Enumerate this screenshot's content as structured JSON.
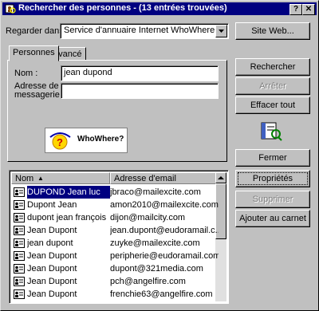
{
  "window": {
    "title": "Rechercher des personnes - (13 entrées trouvées)",
    "help_glyph": "?",
    "close_glyph": "✕"
  },
  "search": {
    "look_in_label": "Regarder dans :",
    "look_in_value": "Service d'annuaire Internet WhoWhere",
    "tabs": [
      "Personnes",
      "Avancé"
    ],
    "name_label": "Nom :",
    "name_value": "jean dupond",
    "email_label_line1": "Adresse de",
    "email_label_line2": "messagerie :",
    "email_value": "",
    "logo_text": "WhoWhere?"
  },
  "buttons": {
    "site_web": "Site Web...",
    "rechercher": "Rechercher",
    "arreter": "Arrêter",
    "effacer_tout": "Effacer tout",
    "fermer": "Fermer",
    "proprietes": "Propriétés",
    "supprimer": "Supprimer",
    "ajouter": "Ajouter au carnet"
  },
  "results": {
    "columns": [
      "Nom",
      "Adresse d'email"
    ],
    "rows": [
      {
        "name": "DUPOND Jean luc",
        "email": "jbraco@mailexcite.com"
      },
      {
        "name": "Dupont Jean",
        "email": "amon2010@mailexcite.com"
      },
      {
        "name": "dupont jean françois",
        "email": "dijon@mailcity.com"
      },
      {
        "name": "Jean Dupont",
        "email": "jean.dupont@eudoramail.c..."
      },
      {
        "name": "jean dupont",
        "email": "zuyke@mailexcite.com"
      },
      {
        "name": "Jean Dupont",
        "email": "peripherie@eudoramail.com"
      },
      {
        "name": "Jean Dupont",
        "email": "dupont@321media.com"
      },
      {
        "name": "Jean Dupont",
        "email": "pch@angelfire.com"
      },
      {
        "name": "Jean Dupont",
        "email": "frenchie63@angelfire.com"
      }
    ],
    "selected_index": 0
  }
}
